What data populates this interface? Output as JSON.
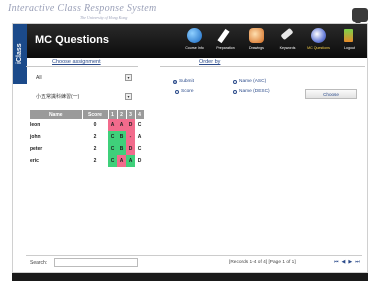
{
  "brand": {
    "name": "Interactive Class Response System",
    "subtitle": "The University of Hong Kong"
  },
  "side_tab": "iClass",
  "header": {
    "title": "MC Questions"
  },
  "nav": [
    {
      "label": "Course Info",
      "icon": "info-icon"
    },
    {
      "label": "Preparation",
      "icon": "pen-icon"
    },
    {
      "label": "Drawings",
      "icon": "drawings-icon"
    },
    {
      "label": "Keywords",
      "icon": "key-icon"
    },
    {
      "label": "MC Questions",
      "icon": "mc-questions-icon",
      "active": true
    },
    {
      "label": "Logout",
      "icon": "logout-icon"
    }
  ],
  "assignment": {
    "heading": "Choose assignment",
    "filter_value": "All",
    "assignment_value": "小五常識科練習(一)"
  },
  "order": {
    "heading": "Order by",
    "options": [
      "Submit",
      "Score",
      "Name (ASC)",
      "Name (DESC)"
    ],
    "selected": "Submit",
    "choose_label": "Choose"
  },
  "table": {
    "columns": [
      "Name",
      "Score",
      "1",
      "2",
      "3",
      "4"
    ],
    "rows": [
      {
        "name": "leon",
        "score": "0",
        "answers": [
          "A",
          "A",
          "D",
          "C"
        ],
        "status": [
          "red",
          "red",
          "red",
          "none"
        ]
      },
      {
        "name": "john",
        "score": "2",
        "answers": [
          "C",
          "B",
          "-",
          "A"
        ],
        "status": [
          "green",
          "green",
          "red",
          "none"
        ]
      },
      {
        "name": "peter",
        "score": "2",
        "answers": [
          "C",
          "B",
          "D",
          "C"
        ],
        "status": [
          "green",
          "green",
          "red",
          "none"
        ]
      },
      {
        "name": "eric",
        "score": "2",
        "answers": [
          "C",
          "A",
          "A",
          "D"
        ],
        "status": [
          "green",
          "red",
          "green",
          "none"
        ]
      }
    ]
  },
  "footer": {
    "search_label": "Search:",
    "search_value": "",
    "records": "[Records 1-4 of 4]  [Page 1 of 1]",
    "pager": [
      "⏮",
      "◀",
      "▶",
      "⏭"
    ]
  }
}
